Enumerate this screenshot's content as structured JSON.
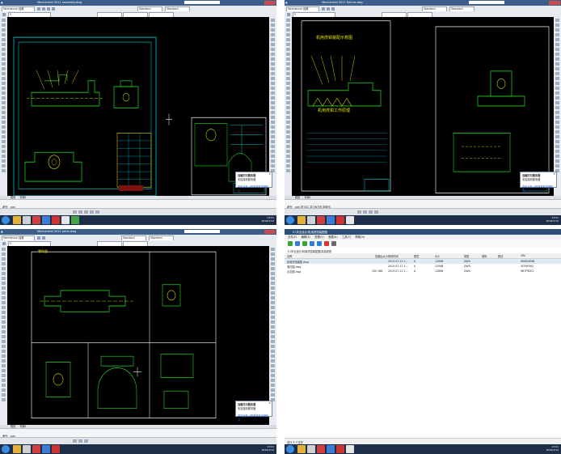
{
  "quadrants": [
    {
      "title": "Mechanical 2011  assembly.dwg",
      "workspace": "Mechanical 经典",
      "style_drop_1": "Standard",
      "style_drop_2": "Standard",
      "layer_drop": "0",
      "model_tab": "模型",
      "layout_tab": "布局1",
      "command_line": "命令: _pan",
      "notify_title": "远端打印服务器",
      "notify_body": "未连接到服务器",
      "notify_link": "单击此处以获得其他详细信息"
    },
    {
      "title": "Mechanical 2011  fixture.dwg",
      "workspace": "Mechanical 经典",
      "style_drop_1": "Standard",
      "style_drop_2": "Standard",
      "layer_drop": "0",
      "model_tab": "模型",
      "layout_tab": "布局1",
      "command_line": "命令: _pan 按 ESC 或 ENTER 键退出",
      "cad_heading_1": "机用虎钳装配示意图",
      "cad_heading_2": "机用虎钳工作原理",
      "notify_title": "远端打印服务器",
      "notify_body": "未连接到服务器",
      "notify_link": "单击此处以获得其他详细信息"
    },
    {
      "title": "Mechanical 2011  parts.dwg",
      "workspace": "Mechanical 经典",
      "style_drop_1": "Standard",
      "style_drop_2": "Standard",
      "layer_drop": "0",
      "model_tab": "模型",
      "layout_tab": "布局1",
      "command_line": "命令: _pan",
      "cad_label": "零件图",
      "notify_title": "远端打印服务器",
      "notify_body": "未连接到服务器",
      "notify_link": "单击此处以获得其他详细信息"
    }
  ],
  "taskbar": {
    "time": "13:01",
    "date": "2016/7/12"
  },
  "explorer": {
    "title": "E:\\毕业设计\\机用虎钳装配图",
    "menu": [
      "文件(F)",
      "编辑(E)",
      "查看(V)",
      "收藏(A)",
      "工具(T)",
      "帮助(H)"
    ],
    "address": "E:\\毕业设计\\机用虎钳装配图\\机用虎钳",
    "columns": [
      "名称",
      "压缩后大小",
      "修改时间",
      "属性",
      "大小",
      "类型",
      "密码",
      "算法",
      "CRC"
    ],
    "rows": [
      [
        "机用虎钳装配.dwg",
        "",
        "2015-07-12 1...",
        "A",
        "129KB",
        "DWG",
        "",
        "",
        "9D8D0E6B"
      ],
      [
        "零件图.dwg",
        "",
        "2015-07-12 1...",
        "A",
        "125KB",
        "DWG",
        "",
        "",
        "3CF6FE61"
      ],
      [
        "示意图.dwg",
        "100 168",
        "2015-07-12 1...",
        "A",
        "128KB",
        "DWG",
        "",
        "",
        "9B7F9DC1"
      ]
    ],
    "status": "总计 3 个文件"
  },
  "colors": {
    "cad_background": "#000000",
    "title_bar": "#3b5f8a",
    "taskbar": "#1d2f48",
    "cad_yellow": "#e4e400",
    "cad_cyan": "#00d8e6",
    "cad_green": "#22d622"
  }
}
